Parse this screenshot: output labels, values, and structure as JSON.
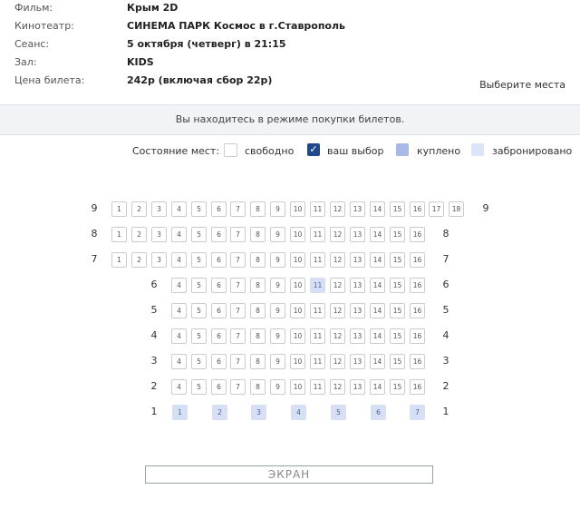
{
  "info": [
    {
      "label": "Фильм:",
      "value": "Крым 2D"
    },
    {
      "label": "Кинотеатр:",
      "value": "СИНЕМА ПАРК Космос в г.Ставрополь"
    },
    {
      "label": "Сеанс:",
      "value": "5 октября (четверг) в 21:15"
    },
    {
      "label": "Зал:",
      "value": "KIDS"
    },
    {
      "label": "Цена билета:",
      "value": "242р (включая сбор 22р)"
    }
  ],
  "choose_seats": "Выберите места",
  "banner": "Вы находитесь в режиме покупки билетов.",
  "legend": {
    "caption": "Состояние мест:",
    "free": "свободно",
    "choice": "ваш выбор",
    "bought": "куплено",
    "reserved": "забронировано",
    "choice_mark": "✓"
  },
  "colors": {
    "choice": "#1e4a8c",
    "bought": "#a9b9e6",
    "reserved": "#d6dff3"
  },
  "rows": [
    {
      "row": "9",
      "seats": [
        "1",
        "2",
        "3",
        "4",
        "5",
        "6",
        "7",
        "8",
        "9",
        "10",
        "11",
        "12",
        "13",
        "14",
        "15",
        "16",
        "17",
        "18"
      ],
      "reserved": []
    },
    {
      "row": "8",
      "seats": [
        "1",
        "2",
        "3",
        "4",
        "5",
        "6",
        "7",
        "8",
        "9",
        "10",
        "11",
        "12",
        "13",
        "14",
        "15",
        "16"
      ],
      "reserved": []
    },
    {
      "row": "7",
      "seats": [
        "1",
        "2",
        "3",
        "4",
        "5",
        "6",
        "7",
        "8",
        "9",
        "10",
        "11",
        "12",
        "13",
        "14",
        "15",
        "16"
      ],
      "reserved": []
    },
    {
      "row": "6",
      "seats": [
        "4",
        "5",
        "6",
        "7",
        "8",
        "9",
        "10",
        "11",
        "12",
        "13",
        "14",
        "15",
        "16"
      ],
      "reserved": [
        "11"
      ]
    },
    {
      "row": "5",
      "seats": [
        "4",
        "5",
        "6",
        "7",
        "8",
        "9",
        "10",
        "11",
        "12",
        "13",
        "14",
        "15",
        "16"
      ],
      "reserved": []
    },
    {
      "row": "4",
      "seats": [
        "4",
        "5",
        "6",
        "7",
        "8",
        "9",
        "10",
        "11",
        "12",
        "13",
        "14",
        "15",
        "16"
      ],
      "reserved": []
    },
    {
      "row": "3",
      "seats": [
        "4",
        "5",
        "6",
        "7",
        "8",
        "9",
        "10",
        "11",
        "12",
        "13",
        "14",
        "15",
        "16"
      ],
      "reserved": []
    },
    {
      "row": "2",
      "seats": [
        "4",
        "5",
        "6",
        "7",
        "8",
        "9",
        "10",
        "11",
        "12",
        "13",
        "14",
        "15",
        "16"
      ],
      "reserved": []
    },
    {
      "row": "1",
      "seats": [
        "1",
        "2",
        "3",
        "4",
        "5",
        "6",
        "7"
      ],
      "reserved": [
        "1",
        "2",
        "3",
        "4",
        "5",
        "6",
        "7"
      ]
    }
  ],
  "screen": "ЭКРАН"
}
